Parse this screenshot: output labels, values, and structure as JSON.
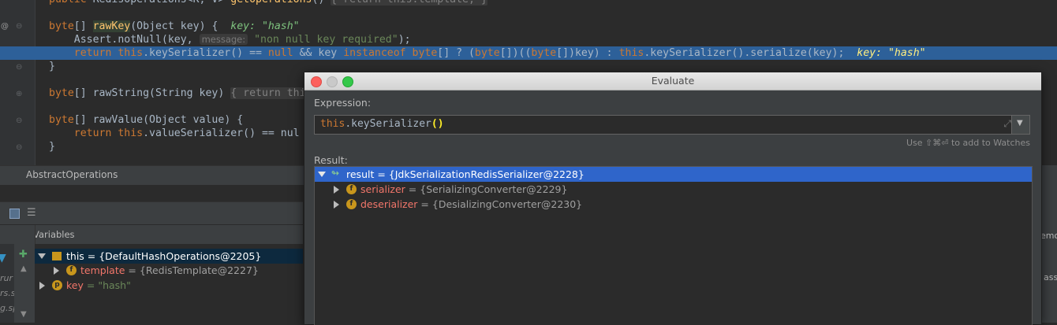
{
  "editor": {
    "lines": [
      {
        "parts": [
          [
            "kw",
            "public "
          ],
          [
            "",
            "RedisOperations<K, V> "
          ],
          [
            "fn",
            "getOperations"
          ],
          [
            "",
            "() "
          ],
          [
            "fold",
            "{ return this.template; }"
          ]
        ]
      },
      {
        "parts": []
      },
      {
        "parts": [
          [
            "kw",
            "byte"
          ],
          [
            "",
            "[] "
          ],
          [
            "rk",
            "rawKey"
          ],
          [
            "",
            "(Object key) {  "
          ],
          [
            "inl",
            "key: \"hash\""
          ]
        ]
      },
      {
        "parts": [
          [
            "",
            "    Assert."
          ],
          [
            "",
            "notNull(key, "
          ],
          [
            "hint",
            "message:"
          ],
          [
            "str",
            " \"non null key required\""
          ],
          [
            "",
            ");"
          ]
        ]
      },
      {
        "parts": [
          [
            "kw",
            "    return this"
          ],
          [
            "",
            ".keySerializer() == "
          ],
          [
            "kw",
            "null"
          ],
          [
            "",
            " && key "
          ],
          [
            "kw",
            "instanceof byte"
          ],
          [
            "",
            "[] ? ("
          ],
          [
            "kw",
            "byte"
          ],
          [
            "",
            "[])(("
          ],
          [
            "kw",
            "byte"
          ],
          [
            "",
            "[])key) : "
          ],
          [
            "kw",
            "this"
          ],
          [
            "",
            ".keySerializer().serialize(key);  "
          ],
          [
            "inl-y",
            "key: \"hash\""
          ]
        ]
      },
      {
        "parts": [
          [
            "",
            "}"
          ]
        ]
      },
      {
        "parts": []
      },
      {
        "parts": [
          [
            "kw",
            "byte"
          ],
          [
            "",
            "[] rawString(String key) "
          ],
          [
            "fold",
            "{ return thi"
          ]
        ]
      },
      {
        "parts": []
      },
      {
        "parts": [
          [
            "kw",
            "byte"
          ],
          [
            "",
            "[] rawValue(Object value) {"
          ]
        ]
      },
      {
        "parts": [
          [
            "kw",
            "    return this"
          ],
          [
            "",
            ".valueSerializer() == nul"
          ]
        ]
      },
      {
        "parts": [
          [
            "",
            "}"
          ]
        ]
      }
    ]
  },
  "breadcrumb": "AbstractOperations",
  "variables_panel": {
    "title": "Variables",
    "rows": [
      {
        "label": "this = {DefaultHashOperations@2205}"
      },
      {
        "name": "template",
        "value": "= {RedisTemplate@2227}",
        "badge": "f"
      },
      {
        "name": "key",
        "value": "= \"hash\"",
        "badge": "p"
      }
    ],
    "left_fragments": [
      "rur",
      "rs.s",
      "g.sp"
    ]
  },
  "dialog": {
    "title": "Evaluate",
    "expression_label": "Expression:",
    "expression_this": "this",
    "expression_rest": ".keySerializer",
    "expression_parens": "()",
    "watches_hint": "Use ⇧⌘⏎ to add to Watches",
    "result_label": "Result:",
    "result_root": "result = {JdkSerializationRedisSerializer@2228}",
    "children": [
      {
        "name": "serializer",
        "value": "= {SerializingConverter@2229}",
        "badge": "f"
      },
      {
        "name": "deserializer",
        "value": "= {DesializingConverter@2230}",
        "badge": "f"
      }
    ]
  },
  "right_fragments": [
    "emo",
    "ass"
  ],
  "colors": {
    "selection": "#2f65ca",
    "exec_line": "#2d6099",
    "keyword": "#cc7832",
    "field_name": "#f2766a"
  }
}
